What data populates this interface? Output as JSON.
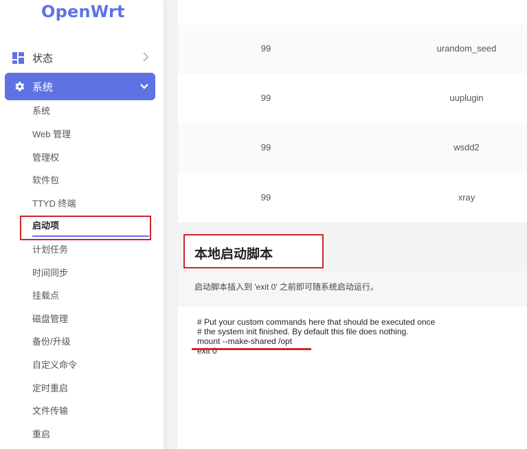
{
  "brand": {
    "logo": "OpenWrt",
    "accent": "#5e72e4",
    "highlight": "#d2232a"
  },
  "sidebar": {
    "status_label": "状态",
    "system_label": "系统",
    "sub_items": [
      {
        "label": "系统"
      },
      {
        "label": "Web 管理"
      },
      {
        "label": "管理权"
      },
      {
        "label": "软件包"
      },
      {
        "label": "TTYD 终端"
      },
      {
        "label": "启动项",
        "active": true
      },
      {
        "label": "计划任务"
      },
      {
        "label": "时间同步"
      },
      {
        "label": "挂载点"
      },
      {
        "label": "磁盘管理"
      },
      {
        "label": "备份/升级"
      },
      {
        "label": "自定义命令"
      },
      {
        "label": "定时重启"
      },
      {
        "label": "文件传输"
      },
      {
        "label": "重启"
      }
    ]
  },
  "table": {
    "rows": [
      {
        "priority": "99",
        "name": "urandom_seed"
      },
      {
        "priority": "99",
        "name": "uuplugin"
      },
      {
        "priority": "99",
        "name": "wsdd2"
      },
      {
        "priority": "99",
        "name": "xray"
      }
    ]
  },
  "local_startup": {
    "title": "本地启动脚本",
    "description": "启动脚本插入到 'exit 0' 之前即可随系统启动运行。",
    "script_lines": [
      "# Put your custom commands here that should be executed once",
      "# the system init finished. By default this file does nothing.",
      "mount --make-shared /opt",
      "exit 0"
    ]
  }
}
